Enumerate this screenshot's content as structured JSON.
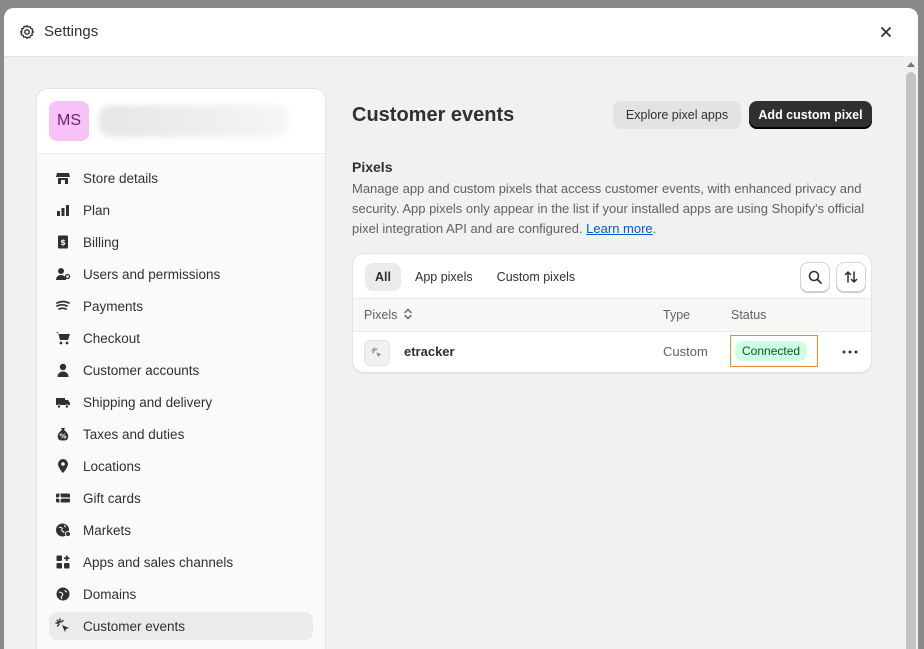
{
  "window": {
    "title": "Settings"
  },
  "store": {
    "initials": "MS"
  },
  "sidebar": {
    "items": [
      {
        "label": "Store details",
        "icon": "store-icon"
      },
      {
        "label": "Plan",
        "icon": "plan-icon"
      },
      {
        "label": "Billing",
        "icon": "billing-icon"
      },
      {
        "label": "Users and permissions",
        "icon": "users-icon"
      },
      {
        "label": "Payments",
        "icon": "payments-icon"
      },
      {
        "label": "Checkout",
        "icon": "cart-icon"
      },
      {
        "label": "Customer accounts",
        "icon": "person-icon"
      },
      {
        "label": "Shipping and delivery",
        "icon": "truck-icon"
      },
      {
        "label": "Taxes and duties",
        "icon": "money-bag-icon"
      },
      {
        "label": "Locations",
        "icon": "location-pin-icon"
      },
      {
        "label": "Gift cards",
        "icon": "gift-card-icon"
      },
      {
        "label": "Markets",
        "icon": "globe-icon"
      },
      {
        "label": "Apps and sales channels",
        "icon": "apps-icon"
      },
      {
        "label": "Domains",
        "icon": "domain-globe-icon"
      },
      {
        "label": "Customer events",
        "icon": "cursor-click-icon",
        "active": true
      }
    ]
  },
  "main": {
    "title": "Customer events",
    "explore_button": "Explore pixel apps",
    "add_button": "Add custom pixel",
    "section_title": "Pixels",
    "description": "Manage app and custom pixels that access customer events, with enhanced privacy and security. App pixels only appear in the list if your installed apps are using Shopify's official pixel integration API and are configured.",
    "learn_more": "Learn more",
    "tabs": [
      "All",
      "App pixels",
      "Custom pixels"
    ],
    "table": {
      "headers": {
        "pixels": "Pixels",
        "type": "Type",
        "status": "Status"
      },
      "rows": [
        {
          "name": "etracker",
          "type": "Custom",
          "status": "Connected"
        }
      ]
    }
  },
  "colors": {
    "primary_button": "#303030",
    "badge_bg": "#cdfee1",
    "badge_text": "#0c5132",
    "link": "#005bd3",
    "highlight_outline": "#f08a2a",
    "avatar_bg": "#f7c2f5"
  }
}
